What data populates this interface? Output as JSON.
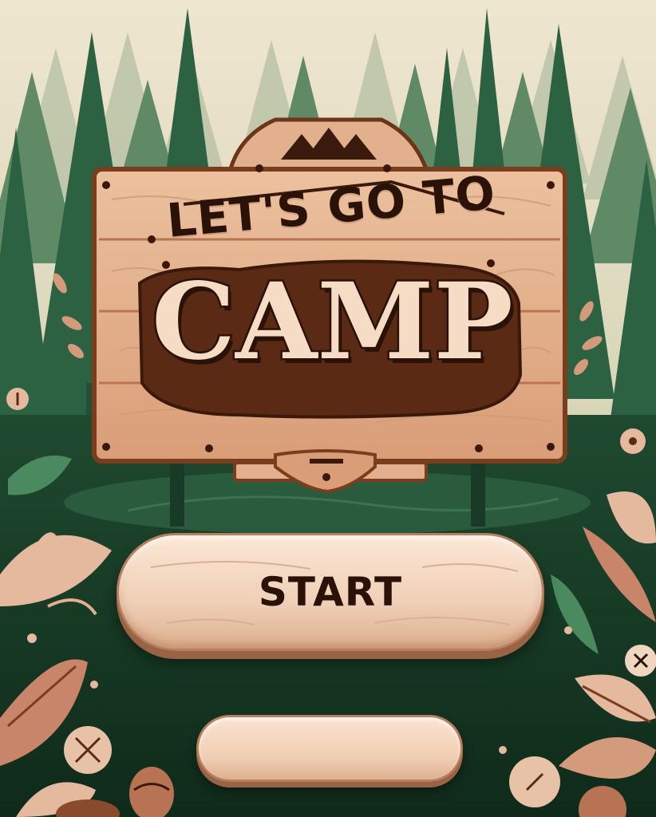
{
  "title": {
    "line1": "LET'S GO TO",
    "line2": "CAMP"
  },
  "buttons": {
    "start_label": "START",
    "secondary_label": ""
  },
  "icons": [
    "mountain-icon",
    "pin-icon",
    "leaf-icon",
    "acorn-icon",
    "close-icon"
  ],
  "colors": {
    "forest_dark": "#13321f",
    "forest_mid": "#2e6a45",
    "sky": "#ede3cc",
    "wood_light": "#e6b590",
    "wood_dark": "#5a2a14",
    "button": "#f6dcc4",
    "ink": "#2a1208"
  }
}
